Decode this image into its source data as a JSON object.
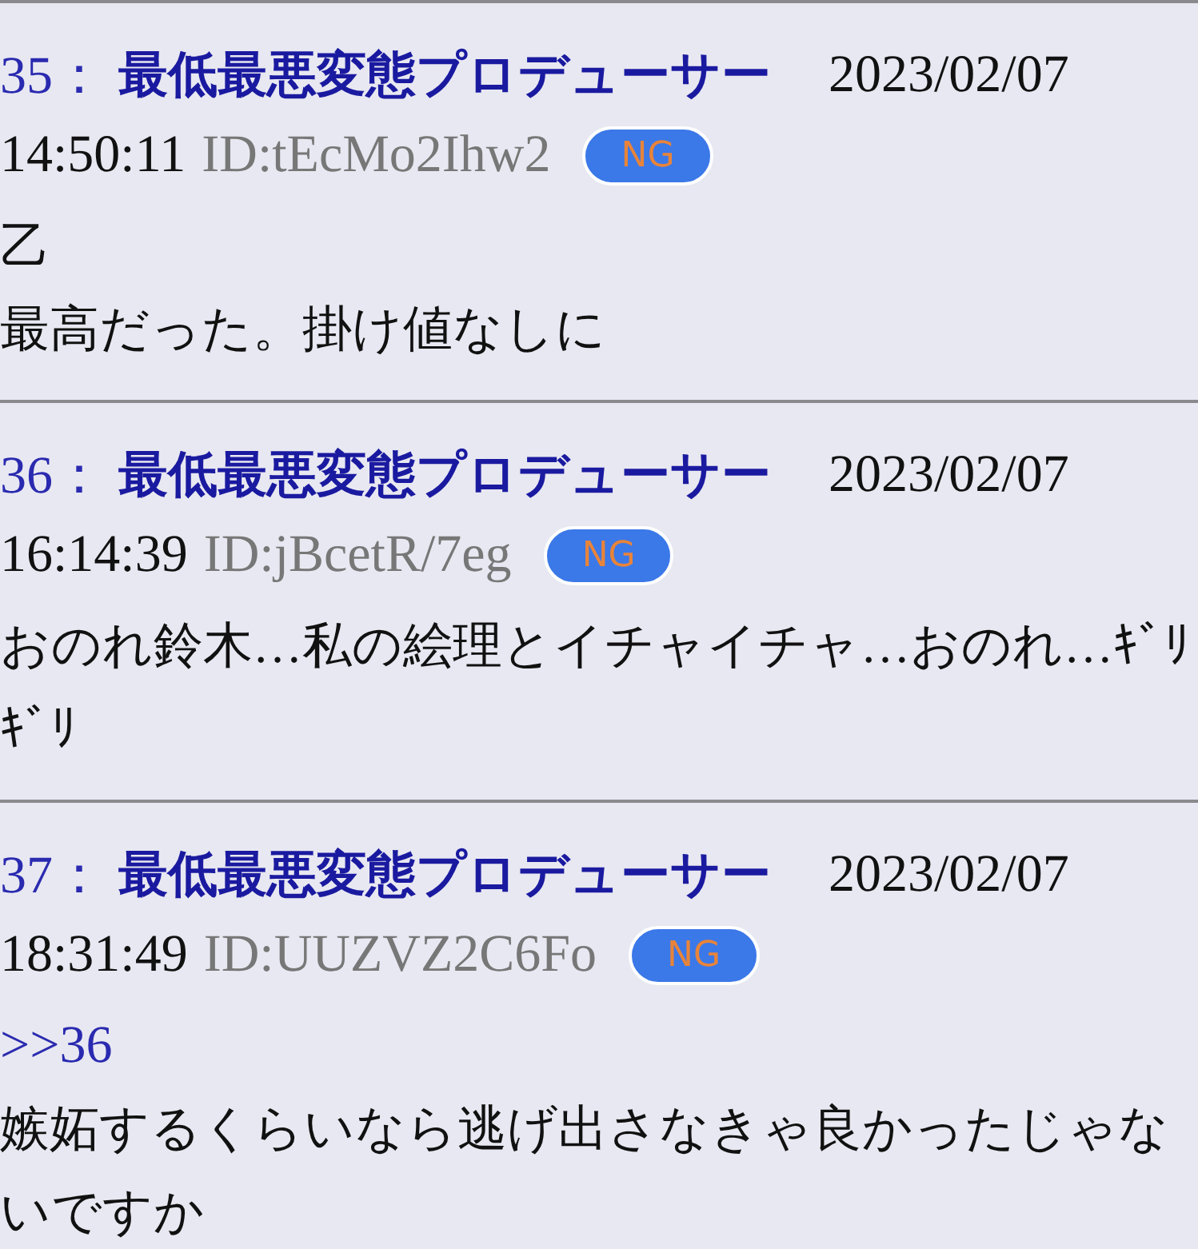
{
  "posts": [
    {
      "number": "35：",
      "name": "最低最悪変態プロデューサー",
      "date": "2023/02/07",
      "time": "14:50:11",
      "id": "ID:tEcMo2Ihw2",
      "ng_button": "NG",
      "lines": [
        "乙",
        "最高だった。掛け値なしに"
      ]
    },
    {
      "number": "36：",
      "name": "最低最悪変態プロデューサー",
      "date": "2023/02/07",
      "time": "16:14:39",
      "id": "ID:jBcetR/7eg",
      "ng_button": "NG",
      "lines": [
        "おのれ鈴木…私の絵理とイチャイチャ…おのれ…ｷﾞﾘｷﾞﾘ"
      ]
    },
    {
      "number": "37：",
      "name": "最低最悪変態プロデューサー",
      "date": "2023/02/07",
      "time": "18:31:49",
      "id": "ID:UUZVZ2C6Fo",
      "ng_button": "NG",
      "anchor": ">>36",
      "lines": [
        "嫉妬するくらいなら逃げ出さなきゃ良かったじゃないですか"
      ]
    }
  ]
}
